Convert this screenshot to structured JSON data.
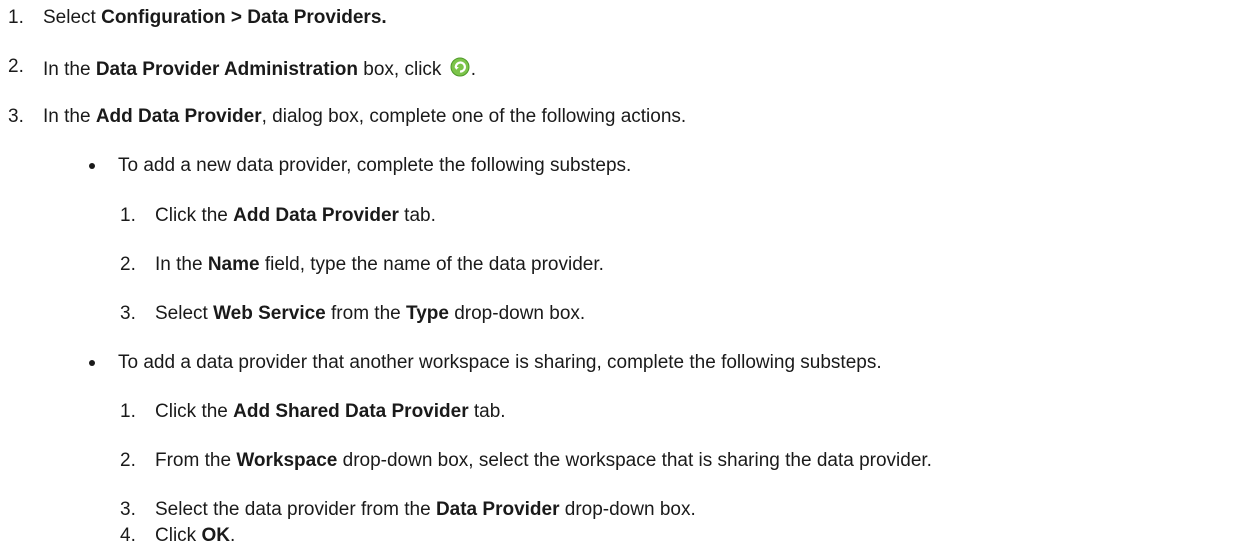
{
  "steps": [
    {
      "number": "1.",
      "parts": [
        {
          "text": "Select ",
          "bold": false
        },
        {
          "text": "Configuration > Data Providers.",
          "bold": true
        }
      ]
    },
    {
      "number": "2.",
      "parts": [
        {
          "text": "In the ",
          "bold": false
        },
        {
          "text": "Data Provider Administration",
          "bold": true
        },
        {
          "text": " box, click ",
          "bold": false
        }
      ],
      "icon": "add-refresh-icon",
      "after_icon": "."
    },
    {
      "number": "3.",
      "parts": [
        {
          "text": "In the ",
          "bold": false
        },
        {
          "text": "Add Data Provider",
          "bold": true
        },
        {
          "text": ", dialog box, complete one of the following actions.",
          "bold": false
        }
      ]
    }
  ],
  "bullets": [
    {
      "text": "To add a new data provider, complete the following substeps.",
      "substeps": [
        {
          "number": "1.",
          "parts": [
            {
              "text": "Click the ",
              "bold": false
            },
            {
              "text": "Add Data Provider",
              "bold": true
            },
            {
              "text": " tab.",
              "bold": false
            }
          ]
        },
        {
          "number": "2.",
          "parts": [
            {
              "text": "In the ",
              "bold": false
            },
            {
              "text": "Name",
              "bold": true
            },
            {
              "text": " field, type the name of the data provider.",
              "bold": false
            }
          ]
        },
        {
          "number": "3.",
          "parts": [
            {
              "text": "Select ",
              "bold": false
            },
            {
              "text": "Web Service",
              "bold": true
            },
            {
              "text": " from the ",
              "bold": false
            },
            {
              "text": "Type",
              "bold": true
            },
            {
              "text": " drop-down box.",
              "bold": false
            }
          ]
        }
      ]
    },
    {
      "text": "To add a data provider that another workspace is sharing, complete the following substeps.",
      "substeps": [
        {
          "number": "1.",
          "parts": [
            {
              "text": "Click the ",
              "bold": false
            },
            {
              "text": "Add Shared Data Provider",
              "bold": true
            },
            {
              "text": " tab.",
              "bold": false
            }
          ]
        },
        {
          "number": "2.",
          "parts": [
            {
              "text": "From the ",
              "bold": false
            },
            {
              "text": "Workspace",
              "bold": true
            },
            {
              "text": " drop-down box, select the workspace that is sharing the data provider.",
              "bold": false
            }
          ]
        },
        {
          "number": "3.",
          "parts": [
            {
              "text": "Select the data provider from the ",
              "bold": false
            },
            {
              "text": "Data Provider",
              "bold": true
            },
            {
              "text": " drop-down box.",
              "bold": false
            }
          ]
        },
        {
          "number": "4.",
          "parts": [
            {
              "text": "Click ",
              "bold": false
            },
            {
              "text": "OK",
              "bold": true
            },
            {
              "text": ".",
              "bold": false
            }
          ]
        }
      ]
    }
  ]
}
